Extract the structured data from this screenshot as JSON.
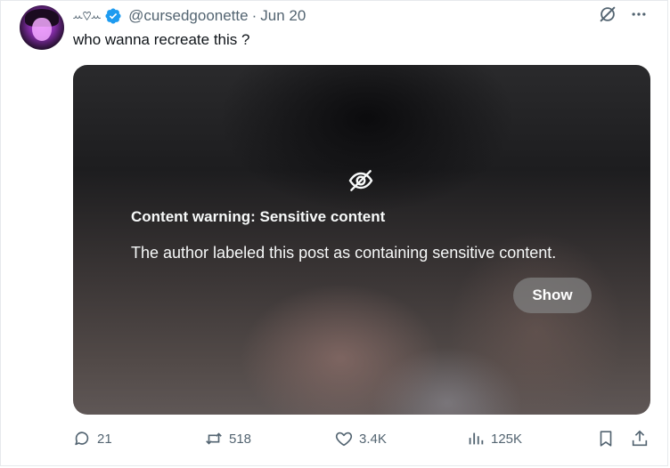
{
  "tweet": {
    "display_name": "ꕀ♡ꕀ",
    "handle": "@cursedgoonette",
    "separator": "·",
    "date": "Jun 20",
    "text": "who wanna recreate this ?"
  },
  "media": {
    "warning_title": "Content warning: Sensitive content",
    "warning_text": "The author labeled this post as containing sensitive content.",
    "show_label": "Show"
  },
  "actions": {
    "replies": "21",
    "reposts": "518",
    "likes": "3.4K",
    "views": "125K"
  },
  "colors": {
    "verified": "#1d9bf0",
    "muted": "#536471",
    "text": "#0f1419"
  },
  "icons": [
    "verified-badge-icon",
    "grok-icon",
    "more-icon",
    "eye-slash-icon",
    "reply-icon",
    "repost-icon",
    "like-icon",
    "views-icon",
    "bookmark-icon",
    "share-icon"
  ]
}
